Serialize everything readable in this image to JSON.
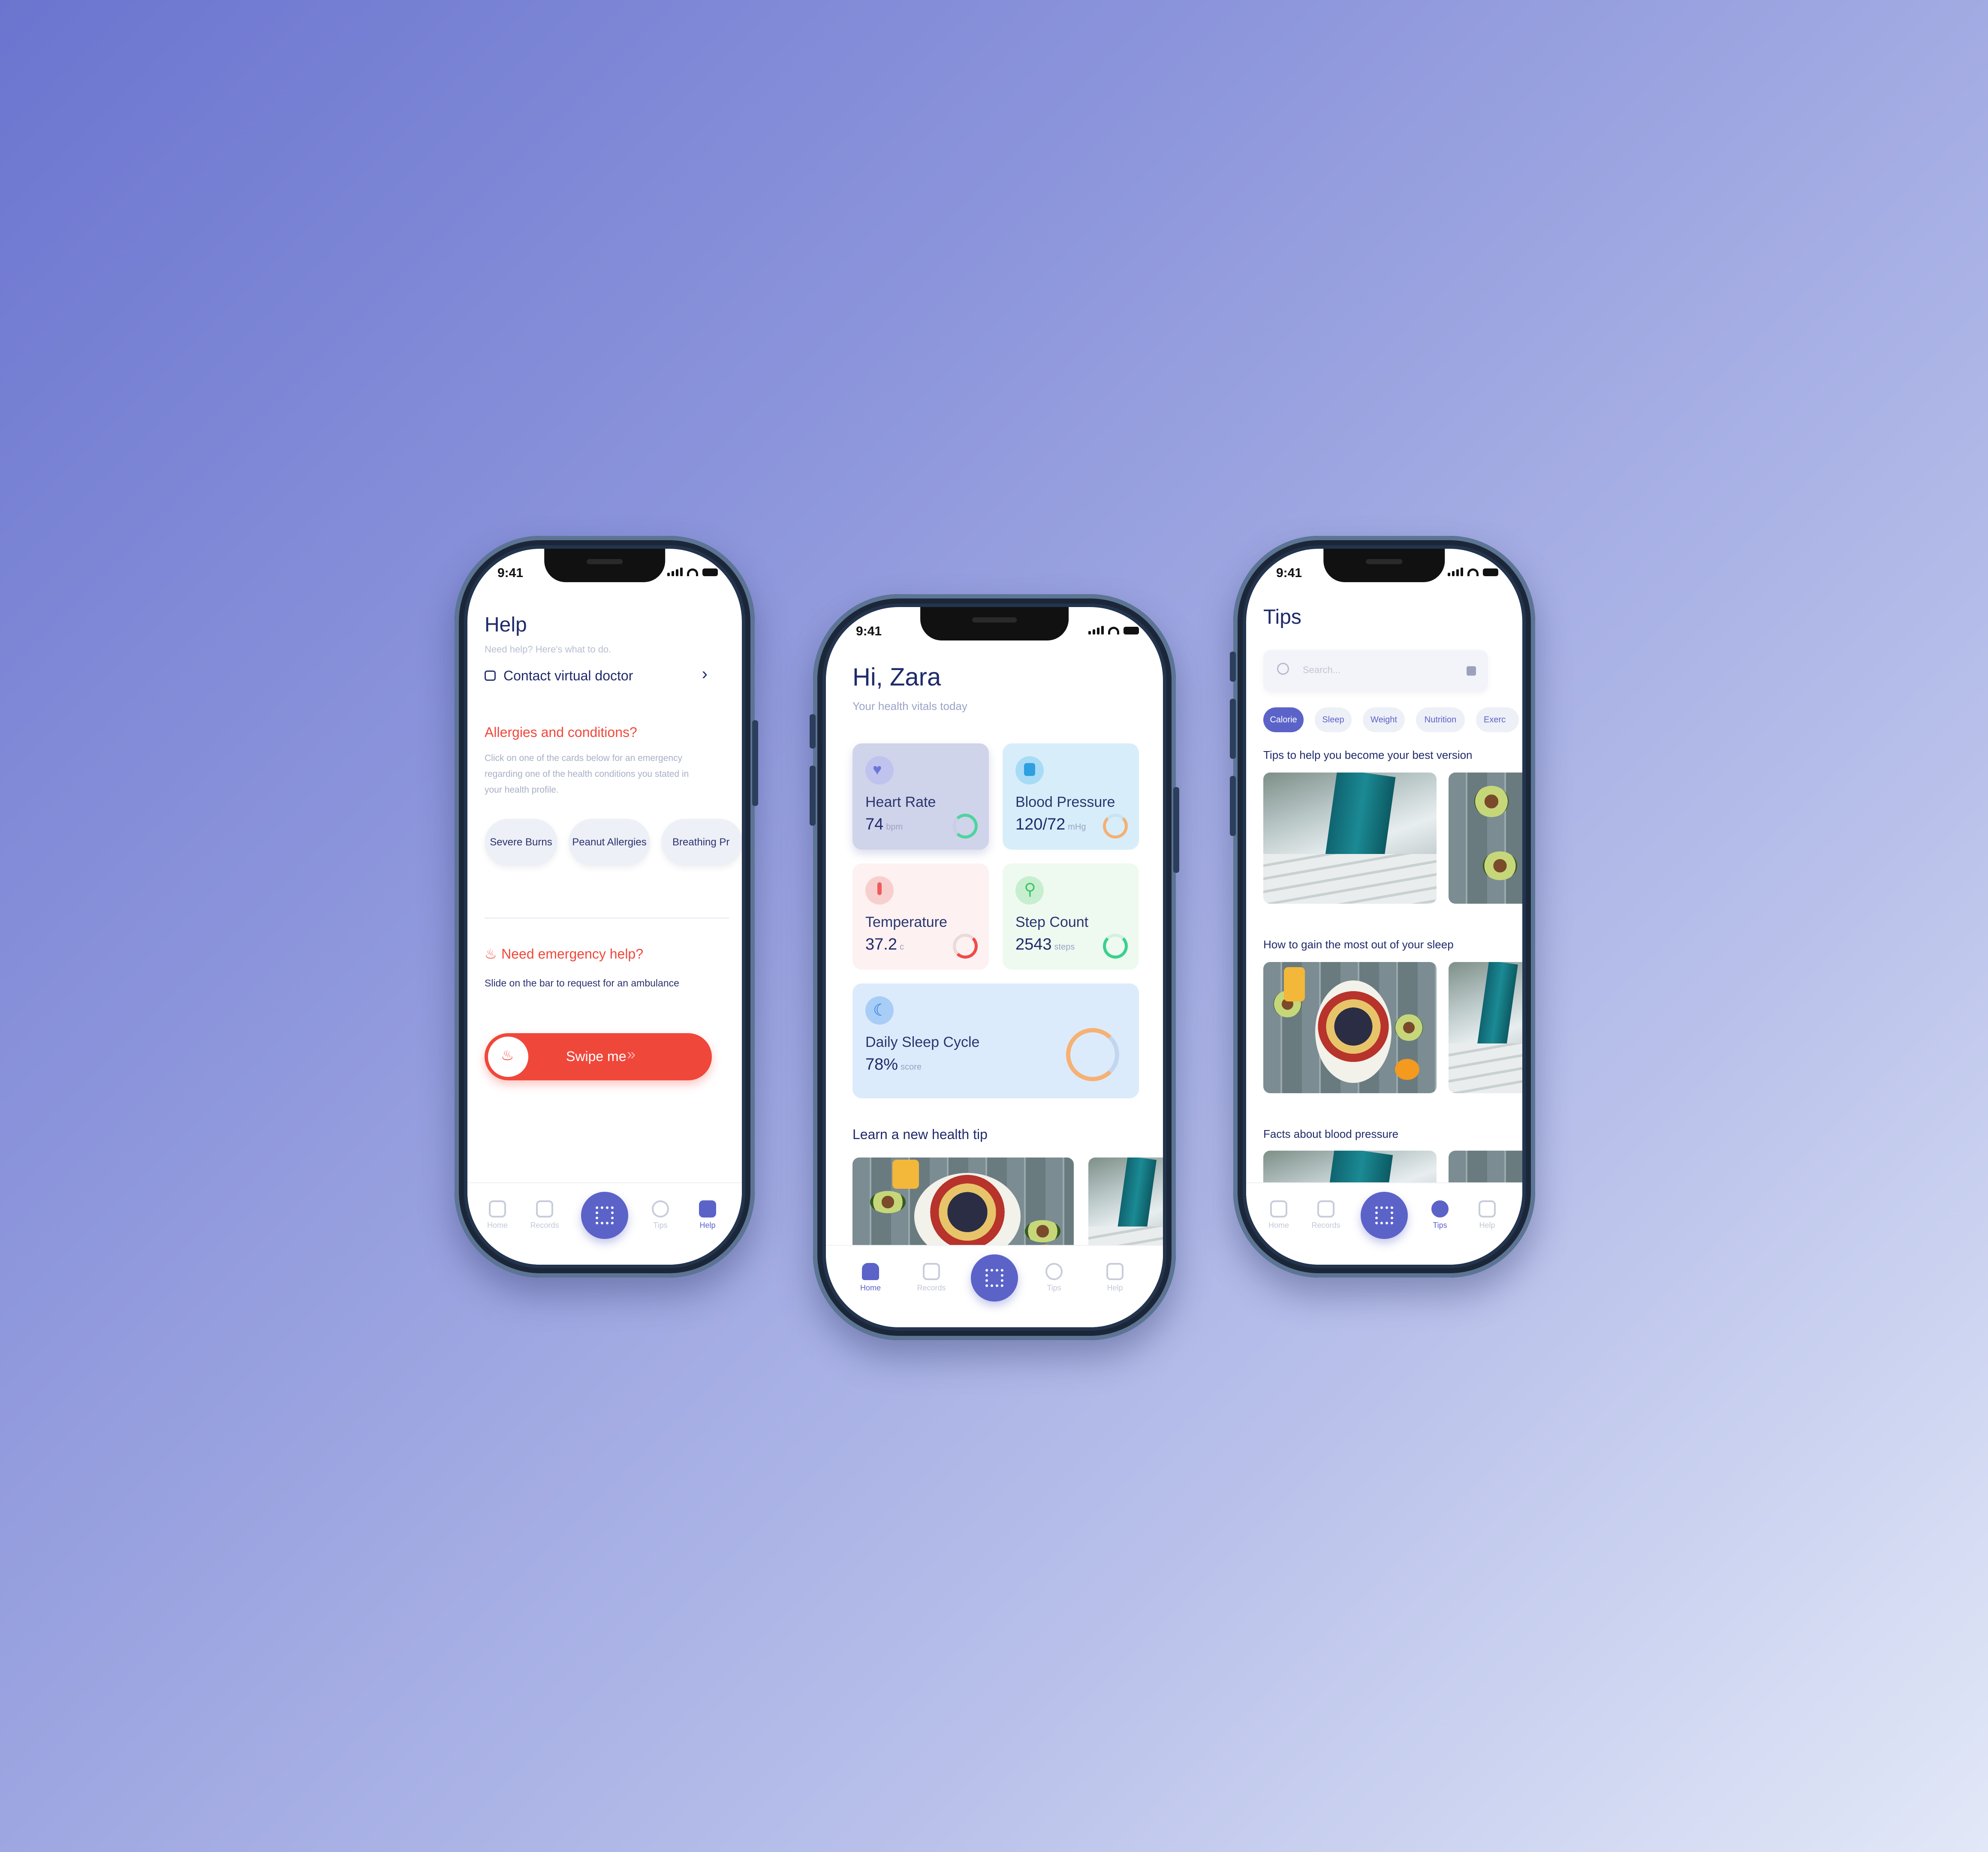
{
  "status_time": "9:41",
  "help_screen": {
    "title": "Help",
    "subtitle": "Need help? Here's what to do.",
    "contact_label": "Contact virtual doctor",
    "allergies_title": "Allergies and conditions?",
    "allergies_desc": "Click on one of the cards below for an emergency regarding one of the health conditions you stated in your health profile.",
    "conditions": [
      "Severe Burns",
      "Peanut Allergies",
      "Breathing Pr"
    ],
    "emergency_title": "Need emergency help?",
    "emergency_desc": "Slide on the bar to request for an ambulance",
    "swipe_label": "Swipe me"
  },
  "home_screen": {
    "greeting": "Hi, Zara",
    "subtitle": "Your health vitals today",
    "vitals": [
      {
        "title": "Heart Rate",
        "value": "74",
        "unit": "bpm"
      },
      {
        "title": "Blood Pressure",
        "value": "120/72",
        "unit": "mHg"
      },
      {
        "title": "Temperature",
        "value": "37.2",
        "unit": "c"
      },
      {
        "title": "Step Count",
        "value": "2543",
        "unit": "steps"
      }
    ],
    "sleep": {
      "title": "Daily Sleep Cycle",
      "value": "78%",
      "unit": "score"
    },
    "tip_heading": "Learn a new health tip"
  },
  "tips_screen": {
    "title": "Tips",
    "search_placeholder": "Search...",
    "categories": [
      "Calorie",
      "Sleep",
      "Weight",
      "Nutrition",
      "Exerc"
    ],
    "sections": [
      "Tips to help you become your best version",
      "How to gain the most out of your sleep",
      "Facts about blood pressure"
    ]
  },
  "tabs": [
    "Home",
    "Records",
    "Tips",
    "Help"
  ],
  "colors": {
    "accent": "#5b63c9",
    "danger": "#f0473b",
    "ink": "#1f2a6b"
  }
}
